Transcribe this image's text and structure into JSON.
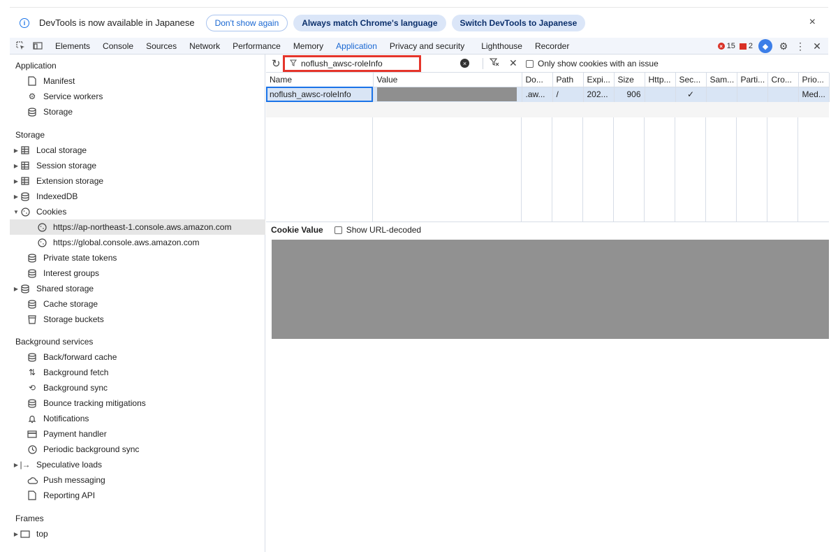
{
  "infobar": {
    "message": "DevTools is now available in Japanese",
    "dont_show": "Don't show again",
    "always_match": "Always match Chrome's language",
    "switch": "Switch DevTools to Japanese",
    "close": "×"
  },
  "tabs": [
    "Elements",
    "Console",
    "Sources",
    "Network",
    "Performance",
    "Memory",
    "Application",
    "Privacy and security",
    "Lighthouse",
    "Recorder"
  ],
  "active_tab": "Application",
  "status": {
    "errors": "15",
    "warnings": "2"
  },
  "sidebar": {
    "application_title": "Application",
    "application_items": [
      "Manifest",
      "Service workers",
      "Storage"
    ],
    "storage_title": "Storage",
    "storage_items": [
      "Local storage",
      "Session storage",
      "Extension storage",
      "IndexedDB",
      "Cookies"
    ],
    "cookie_origins": [
      "https://ap-northeast-1.console.aws.amazon.com",
      "https://global.console.aws.amazon.com"
    ],
    "storage_items_more": [
      "Private state tokens",
      "Interest groups",
      "Shared storage",
      "Cache storage",
      "Storage buckets"
    ],
    "background_title": "Background services",
    "background_items": [
      "Back/forward cache",
      "Background fetch",
      "Background sync",
      "Bounce tracking mitigations",
      "Notifications",
      "Payment handler",
      "Periodic background sync",
      "Speculative loads",
      "Push messaging",
      "Reporting API"
    ],
    "frames_title": "Frames",
    "frames_items": [
      "top"
    ]
  },
  "toolbar": {
    "filter_value": "noflush_awsc-roleInfo",
    "only_issues": "Only show cookies with an issue"
  },
  "table": {
    "headers": [
      "Name",
      "Value",
      "Do...",
      "Path",
      "Expi...",
      "Size",
      "Http...",
      "Sec...",
      "Sam...",
      "Parti...",
      "Cro...",
      "Prio..."
    ],
    "rows": [
      {
        "name": "noflush_awsc-roleInfo",
        "value": "",
        "domain": ".aw...",
        "path": "/",
        "expires": "202...",
        "size": "906",
        "httponly": "",
        "secure": "✓",
        "samesite": "",
        "partition": "",
        "cross": "",
        "priority": "Med..."
      }
    ]
  },
  "cookie_value": {
    "title": "Cookie Value",
    "show_decoded": "Show URL-decoded"
  },
  "colors": {
    "accent": "#1967d2",
    "highlight": "#e5352b",
    "redacted": "#8f8f8f"
  }
}
